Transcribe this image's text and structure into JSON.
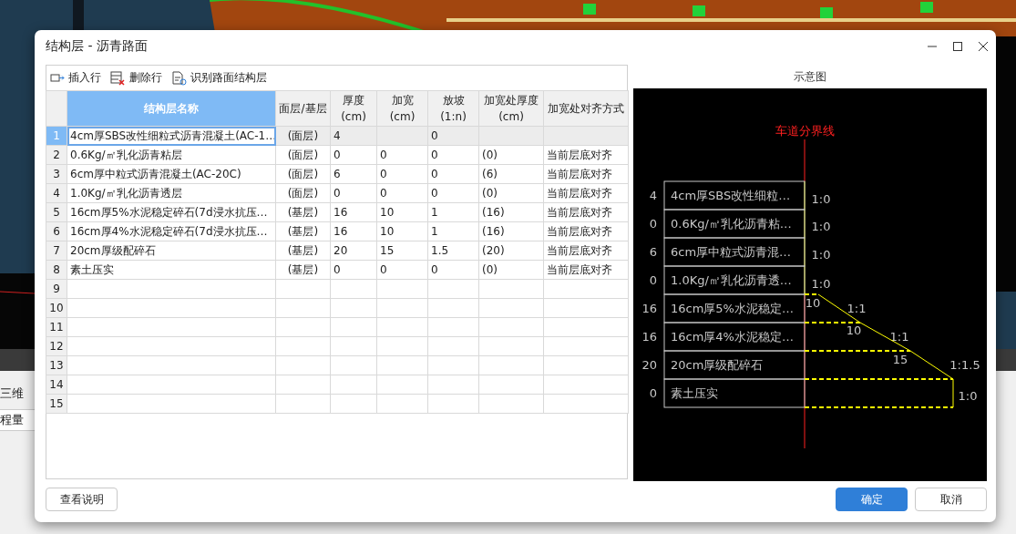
{
  "background_app": {
    "tab": "三维",
    "row_label": "程量"
  },
  "dialog": {
    "title": "结构层 - 沥青路面",
    "toolbar": [
      {
        "kind": "insert",
        "label": "插入行"
      },
      {
        "kind": "delete",
        "label": "删除行"
      },
      {
        "kind": "recognize",
        "label": "识别路面结构层"
      }
    ],
    "table": {
      "columns": [
        {
          "label": "结构层名称",
          "highlighted": true
        },
        {
          "label": "面层/基层",
          "highlighted": false
        },
        {
          "label": "厚度",
          "unit": "(cm)",
          "highlighted": false
        },
        {
          "label": "加宽",
          "unit": "(cm)",
          "highlighted": false
        },
        {
          "label": "放坡",
          "unit": "(1:n)",
          "highlighted": false
        },
        {
          "label": "加宽处厚度",
          "unit": "(cm)",
          "highlighted": false
        },
        {
          "label": "加宽处对齐方式",
          "highlighted": false
        }
      ],
      "rows": [
        {
          "number": "1",
          "selected": true,
          "cells": [
            "4cm厚SBS改性细粒式沥青混凝土(AC-1…",
            "(面层)",
            "4",
            null,
            "0",
            null,
            null
          ]
        },
        {
          "number": "2",
          "selected": false,
          "cells": [
            "0.6Kg/㎡乳化沥青粘层",
            "(面层)",
            "0",
            "0",
            "0",
            "(0)",
            "当前层底对齐"
          ]
        },
        {
          "number": "3",
          "selected": false,
          "cells": [
            "6cm厚中粒式沥青混凝土(AC-20C)",
            "(面层)",
            "6",
            "0",
            "0",
            "(6)",
            "当前层底对齐"
          ]
        },
        {
          "number": "4",
          "selected": false,
          "cells": [
            "1.0Kg/㎡乳化沥青透层",
            "(面层)",
            "0",
            "0",
            "0",
            "(0)",
            "当前层底对齐"
          ]
        },
        {
          "number": "5",
          "selected": false,
          "cells": [
            "16cm厚5%水泥稳定碎石(7d浸水抗压…",
            "(基层)",
            "16",
            "10",
            "1",
            "(16)",
            "当前层底对齐"
          ]
        },
        {
          "number": "6",
          "selected": false,
          "cells": [
            "16cm厚4%水泥稳定碎石(7d浸水抗压…",
            "(基层)",
            "16",
            "10",
            "1",
            "(16)",
            "当前层底对齐"
          ]
        },
        {
          "number": "7",
          "selected": false,
          "cells": [
            "20cm厚级配碎石",
            "(基层)",
            "20",
            "15",
            "1.5",
            "(20)",
            "当前层底对齐"
          ]
        },
        {
          "number": "8",
          "selected": false,
          "cells": [
            "素土压实",
            "(基层)",
            "0",
            "0",
            "0",
            "(0)",
            "当前层底对齐"
          ]
        },
        {
          "number": "9",
          "selected": false
        },
        {
          "number": "10",
          "selected": false
        },
        {
          "number": "11",
          "selected": false
        },
        {
          "number": "12",
          "selected": false
        },
        {
          "number": "13",
          "selected": false
        },
        {
          "number": "14",
          "selected": false
        },
        {
          "number": "15",
          "selected": false
        }
      ]
    },
    "diagram": {
      "title": "示意图",
      "divider_label": "车道分界线",
      "layers": [
        {
          "thickness": "4",
          "name": "4cm厚SBS改性细粒…",
          "ratio": "1:0"
        },
        {
          "thickness": "0",
          "name": "0.6Kg/㎡乳化沥青粘…",
          "ratio": "1:0"
        },
        {
          "thickness": "6",
          "name": "6cm厚中粒式沥青混…",
          "ratio": "1:0"
        },
        {
          "thickness": "0",
          "name": "1.0Kg/㎡乳化沥青透…",
          "ratio": "1:0"
        },
        {
          "thickness": "16",
          "name": "16cm厚5%水泥稳定…",
          "ratio": "1:1",
          "widen": "10"
        },
        {
          "thickness": "16",
          "name": "16cm厚4%水泥稳定…",
          "ratio": "1:1",
          "widen": "10"
        },
        {
          "thickness": "20",
          "name": "20cm厚级配碎石",
          "ratio": "1:1.5",
          "widen": "15"
        },
        {
          "thickness": "0",
          "name": "素土压实",
          "ratio": "1:0"
        }
      ]
    },
    "buttons": [
      {
        "kind": "secondary",
        "label": "查看说明"
      },
      {
        "kind": "primary",
        "label": "确定"
      },
      {
        "kind": "secondary",
        "label": "取消"
      }
    ]
  }
}
